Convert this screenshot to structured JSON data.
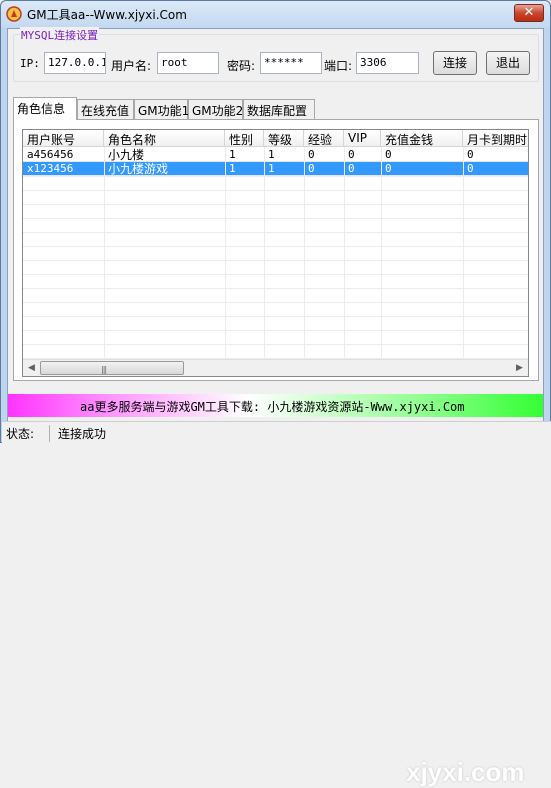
{
  "window": {
    "title": "GM工具aa--Www.xjyxi.Com",
    "close_label": "✕"
  },
  "mysql_group": {
    "title": "MYSQL连接设置",
    "ip_label": "IP:",
    "ip_value": "127.0.0.1",
    "user_label": "用户名:",
    "user_value": "root",
    "pass_label": "密码:",
    "pass_value": "******",
    "port_label": "端口:",
    "port_value": "3306",
    "connect_label": "连接",
    "exit_label": "退出"
  },
  "tabs": [
    "角色信息",
    "在线充值",
    "GM功能1",
    "GM功能2",
    "数据库配置"
  ],
  "table": {
    "columns": [
      "用户账号",
      "角色名称",
      "性别",
      "等级",
      "经验",
      "VIP",
      "充值金钱",
      "月卡到期时"
    ],
    "rows": [
      [
        "a456456",
        "小九楼",
        "1",
        "1",
        "0",
        "0",
        "0",
        "0"
      ],
      [
        "x123456",
        "小九楼游戏",
        "1",
        "1",
        "0",
        "0",
        "0",
        "0"
      ]
    ],
    "selected_row": 1
  },
  "banner": {
    "text": "aa更多服务端与游戏GM工具下载: 小九楼游戏资源站-Www.xjyxi.Com",
    "watermark": "xjyxi.com"
  },
  "status": {
    "label": "状态:",
    "value": "连接成功"
  },
  "icons": {
    "app": "gm-tool-icon",
    "scroll_left": "arrow-left-icon",
    "scroll_right": "arrow-right-icon"
  }
}
